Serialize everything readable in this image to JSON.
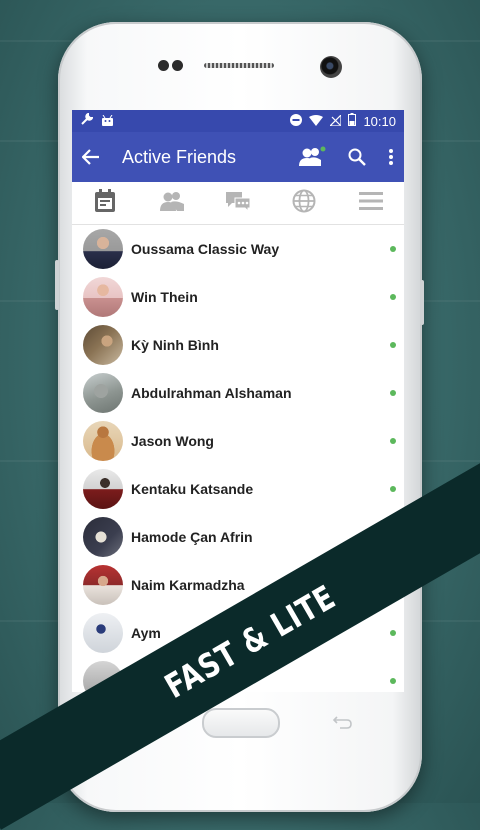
{
  "statusbar": {
    "time": "10:10"
  },
  "toolbar": {
    "title": "Active Friends"
  },
  "tabs": [
    {
      "icon": "calendar-icon"
    },
    {
      "icon": "friends-icon"
    },
    {
      "icon": "chat-icon"
    },
    {
      "icon": "globe-icon"
    },
    {
      "icon": "menu-icon"
    }
  ],
  "friends": [
    {
      "name": "Oussama Classic Way",
      "online": true
    },
    {
      "name": "Win Thein",
      "online": true
    },
    {
      "name": "Kỳ Ninh Bình",
      "online": true
    },
    {
      "name": "Abdulrahman Alshaman",
      "online": true
    },
    {
      "name": "Jason Wong",
      "online": true
    },
    {
      "name": "Kentaku Katsande",
      "online": true
    },
    {
      "name": "Hamode Çan Afrin",
      "online": true
    },
    {
      "name": "Naim Karmadzha",
      "online": true
    },
    {
      "name": "Aym",
      "online": true
    },
    {
      "name": "",
      "online": true
    }
  ],
  "banner": {
    "text": "FAST & LITE"
  },
  "colors": {
    "toolbar": "#3f51b5",
    "statusbar": "#3749ad",
    "online": "#5cb85c",
    "banner": "#0b2a2a"
  }
}
